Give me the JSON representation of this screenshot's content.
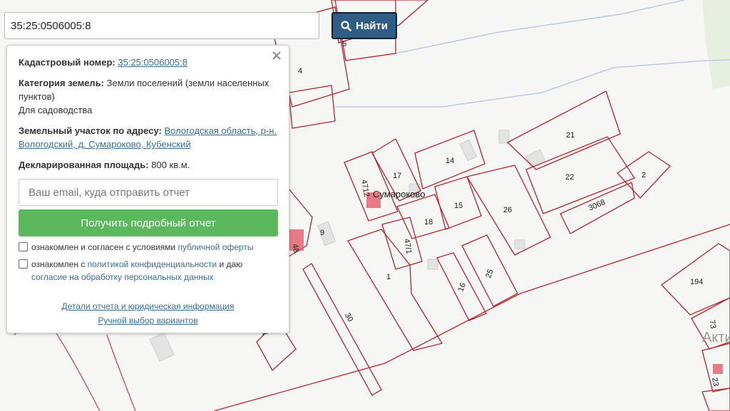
{
  "search": {
    "value": "35:25:0506005:8",
    "button_label": "Найти"
  },
  "info": {
    "cadastral_label": "Кадастровый номер:",
    "cadastral_value": "35:25:0506005:8",
    "category_label": "Категория земель:",
    "category_value": "Земли поселений (земли населенных пунктов)",
    "usage_value": "Для садоводства",
    "address_label": "Земельный участок по адресу:",
    "address_value": "Вологодская область, р-н. Вологодский, д. Сумароково, Кубенский",
    "area_label": "Декларированная площадь:",
    "area_value": "800 кв.м.",
    "email_placeholder": "Ваш email, куда отправить отчет",
    "report_button": "Получить подробный отчет",
    "consent1_text": "ознакомлен и согласен с условиями",
    "consent1_link": "публичной оферты",
    "consent2_text_a": "ознакомлен с",
    "consent2_link_a": "политикой конфиденциальности",
    "consent2_text_b": "и даю",
    "consent2_link_b": "согласие на обработку персональных данных",
    "details_link": "Детали отчета и юридическая информация",
    "manual_link": "Ручной выбор вариантов"
  },
  "map": {
    "village_label": "Сумароково",
    "plot_numbers": [
      "5",
      "4",
      "21",
      "22",
      "2",
      "3068",
      "14",
      "17",
      "4712",
      "15",
      "26",
      "18",
      "47/1",
      "9",
      "48",
      "1",
      "16",
      "25",
      "30",
      "194",
      "73",
      "23",
      "11"
    ],
    "overlay_text": "Акти"
  },
  "colors": {
    "parcel_stroke": "#b3262e",
    "search_button": "#2f5d86",
    "report_button": "#5cb85c",
    "link": "#3a6d95"
  }
}
